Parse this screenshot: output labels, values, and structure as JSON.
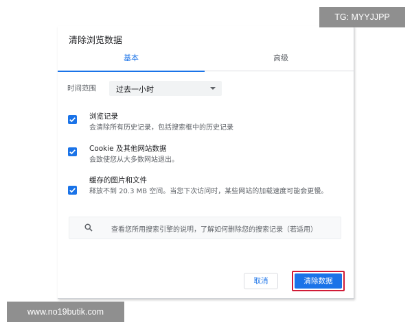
{
  "dialog": {
    "title": "清除浏览数据",
    "tabs": [
      {
        "label": "基本",
        "active": true
      },
      {
        "label": "高级",
        "active": false
      }
    ],
    "time_range": {
      "label": "时间范围",
      "value": "过去一小时"
    },
    "options": [
      {
        "title": "浏览记录",
        "description": "会清除所有历史记录，包括搜索框中的历史记录",
        "checked": true
      },
      {
        "title": "Cookie 及其他网站数据",
        "description": "会致使您从大多数网站退出。",
        "checked": true
      },
      {
        "title": "缓存的图片和文件",
        "description": "释放不到 20.3 MB 空间。当您下次访问时，某些网站的加载速度可能会更慢。",
        "checked": true
      }
    ],
    "search_info": {
      "icon": "search-icon",
      "text": "查看您所用搜索引擎的说明，了解如何删除您的搜索记录（若适用）"
    },
    "buttons": {
      "cancel": "取消",
      "clear": "清除数据"
    }
  },
  "watermarks": {
    "top": "TG: MYYJJPP",
    "bottom": "www.no19butik.com"
  },
  "colors": {
    "accent": "#1a73e8",
    "highlight_outline": "#d01b36"
  }
}
